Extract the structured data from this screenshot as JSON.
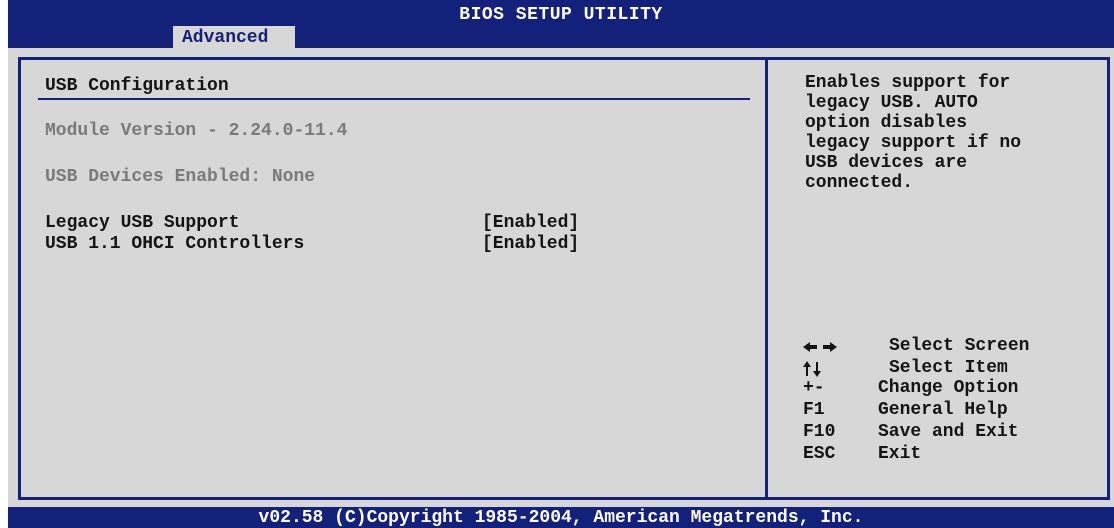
{
  "header": {
    "title": "BIOS SETUP UTILITY",
    "active_tab": "Advanced"
  },
  "main": {
    "heading": "USB Configuration",
    "module_version": "Module Version - 2.24.0-11.4",
    "usb_devices_enabled": "USB Devices Enabled: None",
    "options": [
      {
        "label": "Legacy USB Support",
        "value": "[Enabled]"
      },
      {
        "label": "USB 1.1 OHCI Controllers",
        "value": "[Enabled]"
      }
    ]
  },
  "help": {
    "description": "Enables support for\nlegacy USB. AUTO\noption disables\nlegacy support if no\nUSB devices are\nconnected."
  },
  "keys": [
    {
      "key": "←→",
      "icon": "left-right-arrows-icon",
      "action": "Select Screen"
    },
    {
      "key": "↑↓",
      "icon": "up-down-arrows-icon",
      "action": "Select Item"
    },
    {
      "key": "+-",
      "action": "Change Option"
    },
    {
      "key": "F1",
      "action": "General Help"
    },
    {
      "key": "F10",
      "action": "Save and Exit"
    },
    {
      "key": "ESC",
      "action": "Exit"
    }
  ],
  "footer": {
    "copyright": "v02.58 (C)Copyright 1985-2004, American Megatrends, Inc."
  },
  "colors": {
    "bios_blue": "#14217a",
    "panel_grey": "#d7d7d7",
    "disabled_text": "#7a7a7a"
  }
}
